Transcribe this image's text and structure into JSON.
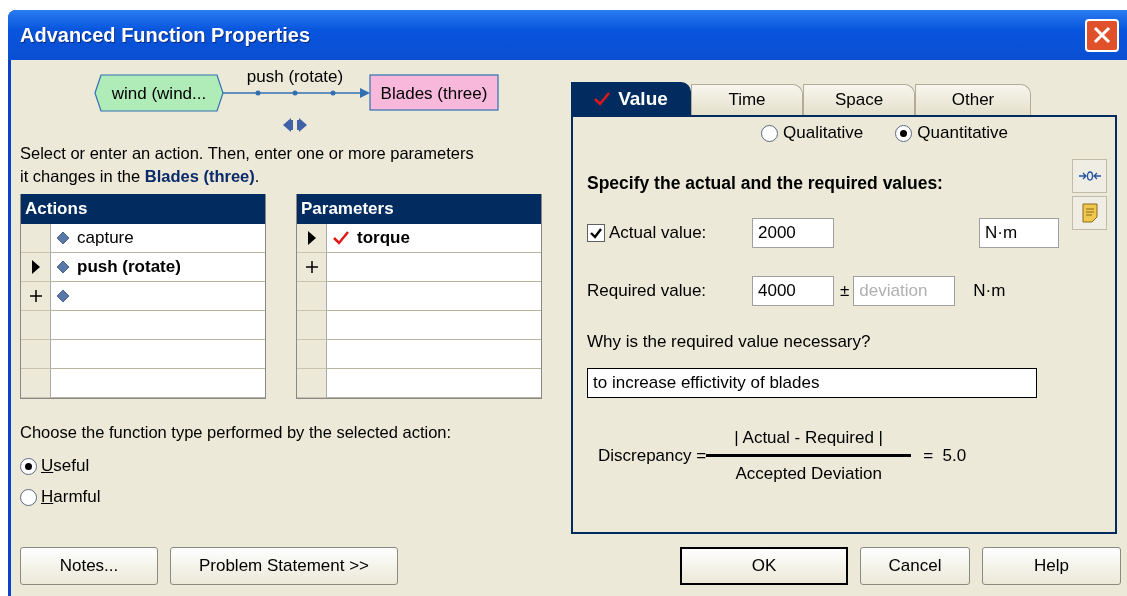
{
  "window": {
    "title": "Advanced Function Properties"
  },
  "diagram": {
    "source": "wind (wind...",
    "action": "push (rotate)",
    "target": "Blades (three)"
  },
  "instruction": "Select or enter an action. Then, enter one or more parameters\nit changes in the **Blades (three)**.",
  "actions": {
    "title": "Actions",
    "rows": [
      {
        "kind": "plain",
        "diamond": true,
        "text": "capture"
      },
      {
        "kind": "current",
        "diamond": true,
        "text": "push (rotate)"
      },
      {
        "kind": "new",
        "diamond": true
      },
      {
        "kind": "plain",
        "diamond": false
      },
      {
        "kind": "plain",
        "diamond": false
      },
      {
        "kind": "plain",
        "diamond": false
      }
    ]
  },
  "parameters": {
    "title": "Parameters",
    "rows": [
      {
        "kind": "current",
        "checked": true,
        "text": "torque"
      },
      {
        "kind": "new",
        "checked": false
      },
      {
        "kind": "plain",
        "checked": false
      },
      {
        "kind": "plain",
        "checked": false
      },
      {
        "kind": "plain",
        "checked": false
      },
      {
        "kind": "plain",
        "checked": false
      }
    ]
  },
  "function_type": {
    "prompt": "Choose the function type performed by the selected action:",
    "options": [
      {
        "mnemonic": "U",
        "rest": "seful",
        "selected": true
      },
      {
        "mnemonic": "H",
        "rest": "armful",
        "selected": false
      }
    ]
  },
  "tabs": [
    {
      "label": "Value",
      "selected": true,
      "checked": true
    },
    {
      "label": "Time",
      "selected": false,
      "checked": false
    },
    {
      "label": "Space",
      "selected": false,
      "checked": false
    },
    {
      "label": "Other",
      "selected": false,
      "checked": false
    }
  ],
  "value_mode": [
    {
      "label": "Qualitative",
      "selected": false
    },
    {
      "label": "Quantitative",
      "selected": true
    }
  ],
  "heading": "Specify the actual and the required values:",
  "actual": {
    "label": "Actual value:",
    "checked": true,
    "value": "2000",
    "unit": "N·m"
  },
  "required": {
    "label": "Required value:",
    "value": "4000",
    "plus_minus": "±",
    "deviation_placeholder": "deviation",
    "unit": "N·m"
  },
  "question": {
    "label": "Why is the required value necessary?",
    "value": "to increase effictivity of blades"
  },
  "formula": {
    "label": "Discrepancy =",
    "numerator": "| Actual - Required |",
    "denominator": "Accepted Deviation",
    "result": "=  5.0"
  },
  "buttons_left": [
    "Notes...",
    "Problem Statement >>"
  ],
  "buttons_right": [
    {
      "label": "OK",
      "default": true
    },
    {
      "label": "Cancel",
      "default": false
    },
    {
      "label": "Help",
      "default": false
    }
  ]
}
